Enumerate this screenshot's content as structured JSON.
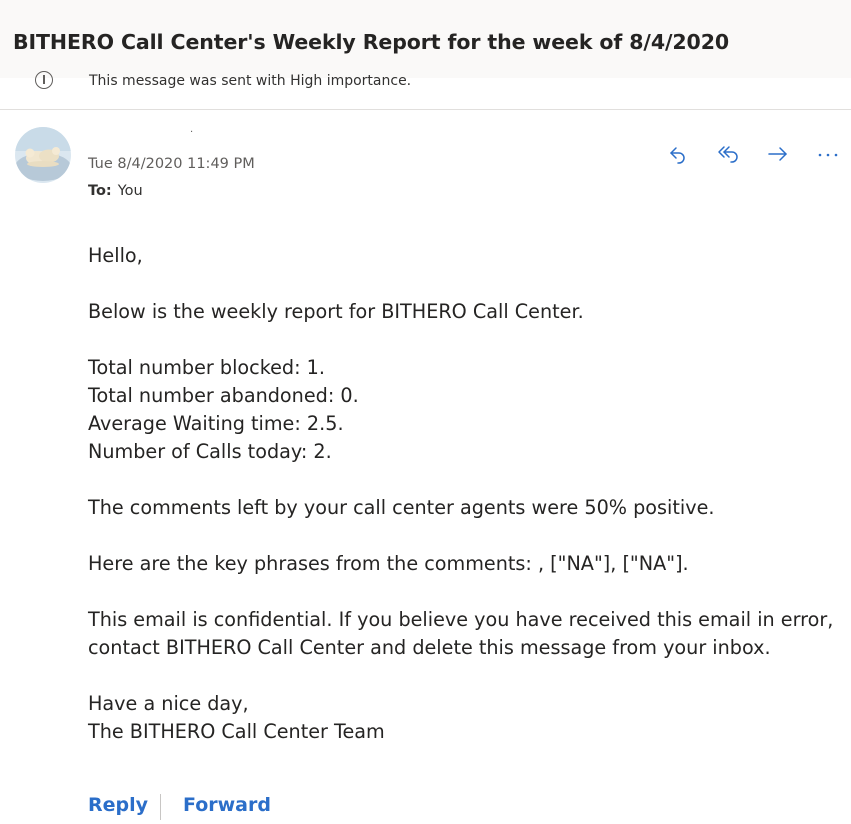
{
  "email": {
    "subject": "BITHERO Call Center's Weekly Report for the week of 8/4/2020",
    "importance_notice": "This message was sent with High importance.",
    "sender_mark": ".",
    "date": "Tue 8/4/2020 11:49 PM",
    "to_label": "To:",
    "to_value": "You",
    "actions": {
      "reply_icon": "reply-icon",
      "reply_all_icon": "reply-all-icon",
      "forward_icon": "forward-icon",
      "more_icon": "more-actions-icon",
      "accent_color": "#2b6ec9"
    },
    "body": {
      "greeting": "Hello,",
      "intro": "Below is the weekly report for BITHERO Call Center.",
      "stat_blocked": "Total number blocked: 1.",
      "stat_abandoned": "Total number abandoned: 0.",
      "stat_waiting": "Average Waiting time: 2.5.",
      "stat_calls": "Number of Calls today: 2.",
      "comments": "The comments left by your call center agents were 50% positive.",
      "key_phrases": "Here are the key phrases from the comments: , [\"NA\"], [\"NA\"].",
      "confidential_1": "This email is confidential. If you believe you have received this email in error,",
      "confidential_2": "contact BITHERO Call Center and delete this message from your inbox.",
      "closing": "Have a nice day,",
      "signature": "The BITHERO Call Center Team"
    },
    "footer": {
      "reply_label": "Reply",
      "forward_label": "Forward"
    }
  }
}
